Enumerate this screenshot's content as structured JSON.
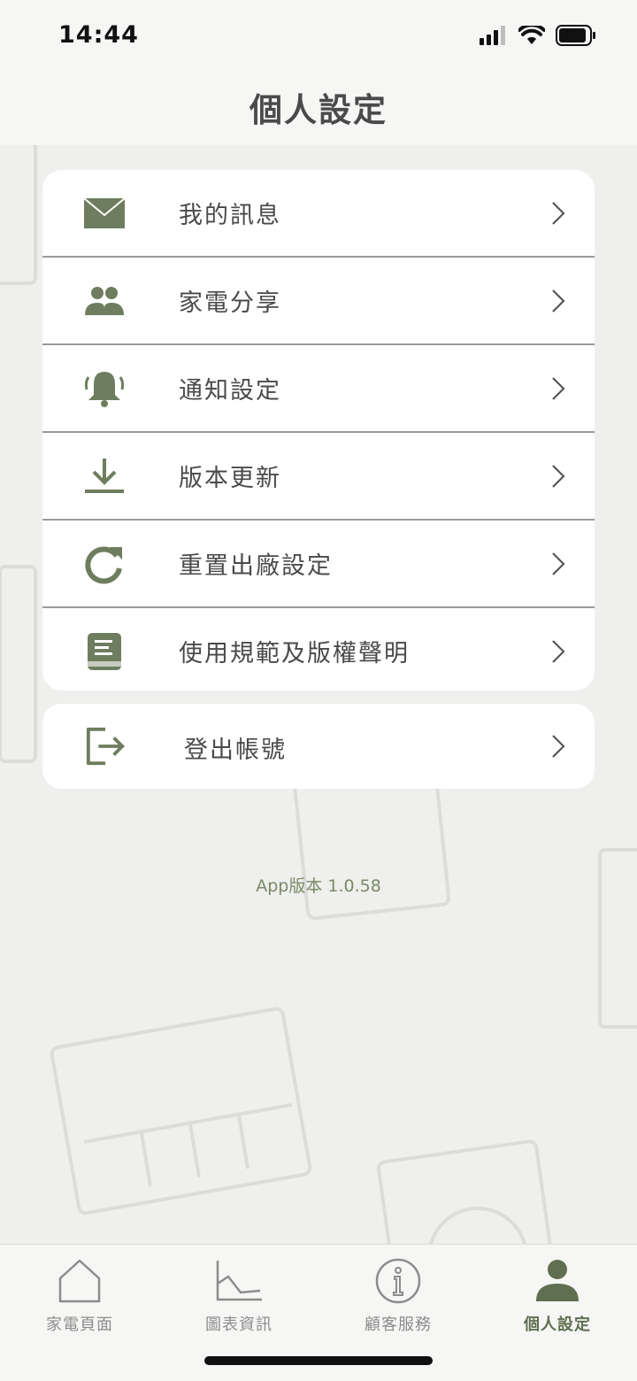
{
  "status_bar": {
    "time": "14:44"
  },
  "header": {
    "title": "個人設定"
  },
  "colors": {
    "accent": "#6e7d5e",
    "version_text": "#7a8a66",
    "tab_inactive": "#8c8c8c",
    "tab_active": "#5f6f50",
    "card_bg": "#ffffff",
    "page_bg": "#efefed"
  },
  "menu": {
    "items": [
      {
        "label": "我的訊息",
        "icon": "envelope-icon"
      },
      {
        "label": "家電分享",
        "icon": "users-icon"
      },
      {
        "label": "通知設定",
        "icon": "bell-icon"
      },
      {
        "label": "版本更新",
        "icon": "download-icon"
      },
      {
        "label": "重置出廠設定",
        "icon": "refresh-icon"
      },
      {
        "label": "使用規範及版權聲明",
        "icon": "book-icon"
      }
    ]
  },
  "logout": {
    "label": "登出帳號",
    "icon": "logout-icon"
  },
  "version_text": "App版本 1.0.58",
  "tab_bar": {
    "tabs": [
      {
        "label": "家電頁面",
        "icon": "home-icon",
        "active": false
      },
      {
        "label": "圖表資訊",
        "icon": "chart-icon",
        "active": false
      },
      {
        "label": "顧客服務",
        "icon": "info-icon",
        "active": false
      },
      {
        "label": "個人設定",
        "icon": "person-icon",
        "active": true
      }
    ]
  }
}
